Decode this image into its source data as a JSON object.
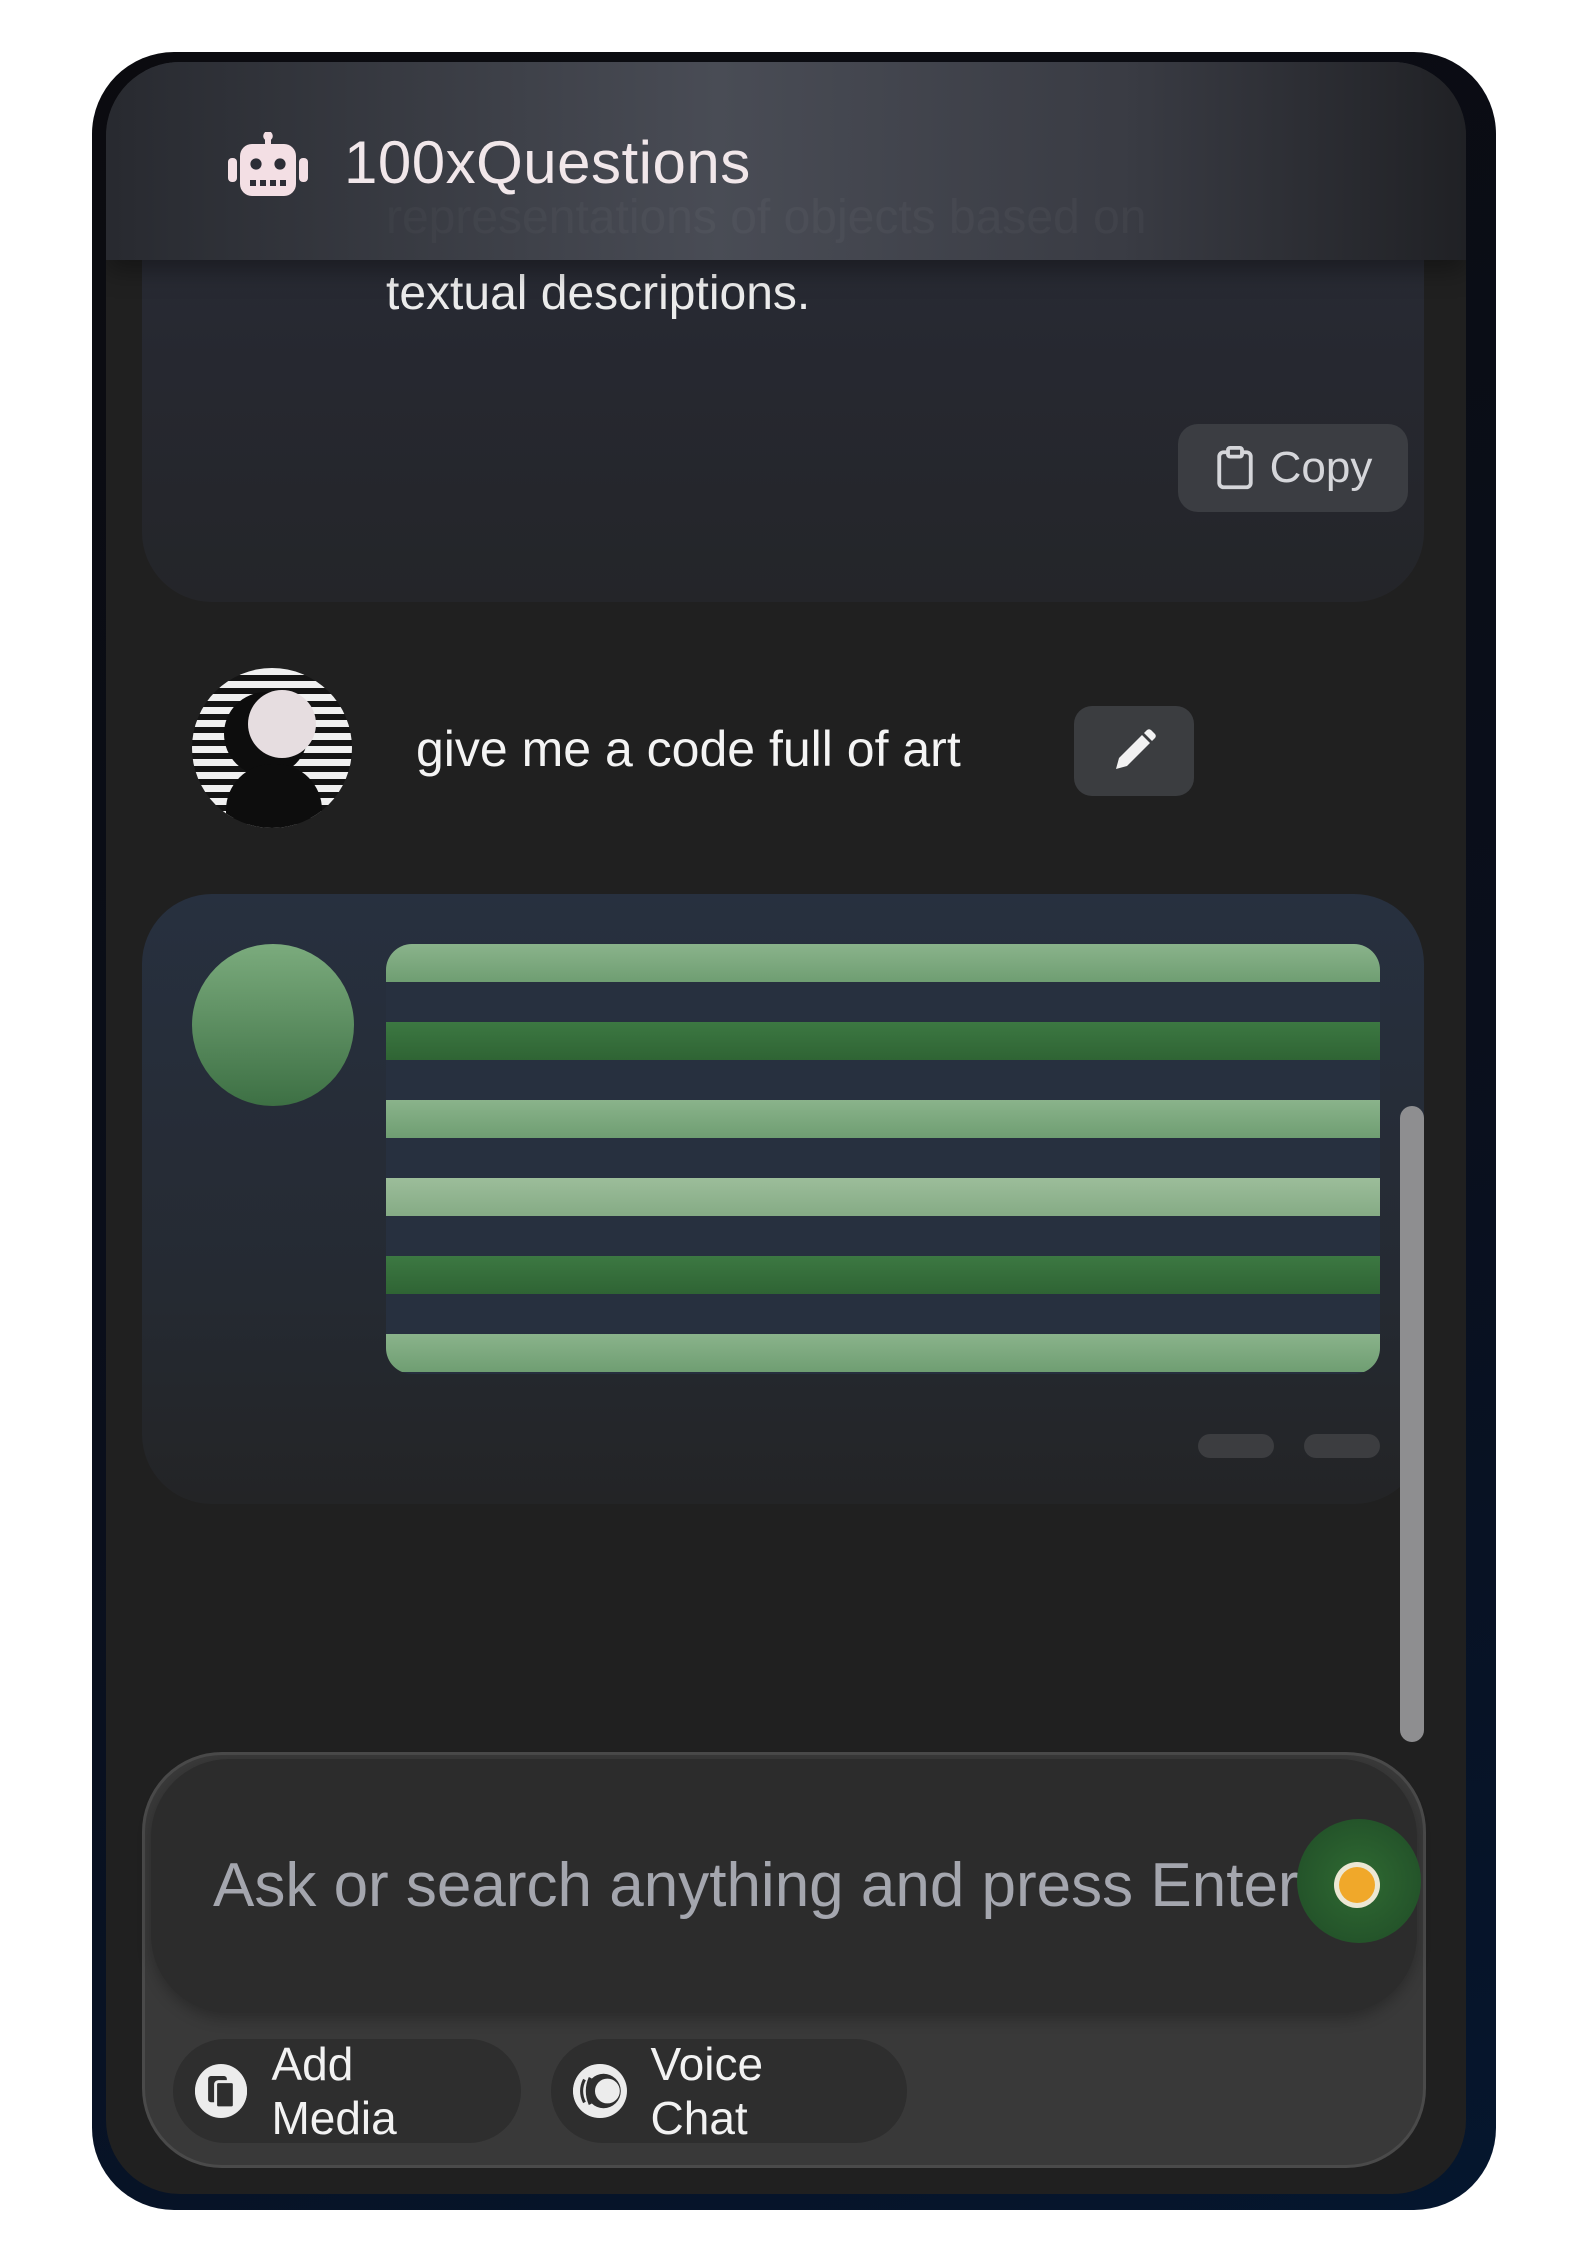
{
  "app": {
    "title": "100xQuestions"
  },
  "previous_reply": {
    "text": "representations of objects based on textual descriptions.",
    "copy_label": "Copy"
  },
  "user_message": {
    "text": "give me a code full of art"
  },
  "composer": {
    "placeholder": "Ask or search anything and press Enter",
    "add_media_label": "Add Media",
    "voice_chat_label": "Voice Chat"
  },
  "icons": {
    "bot": "robot-icon",
    "copy": "clipboard-icon",
    "edit": "pencil-icon",
    "media": "media-icon",
    "voice": "voice-icon"
  },
  "colors": {
    "accent_green": "#6f9e72",
    "send_button": "#2f6a32",
    "send_dot": "#f0a82a"
  }
}
